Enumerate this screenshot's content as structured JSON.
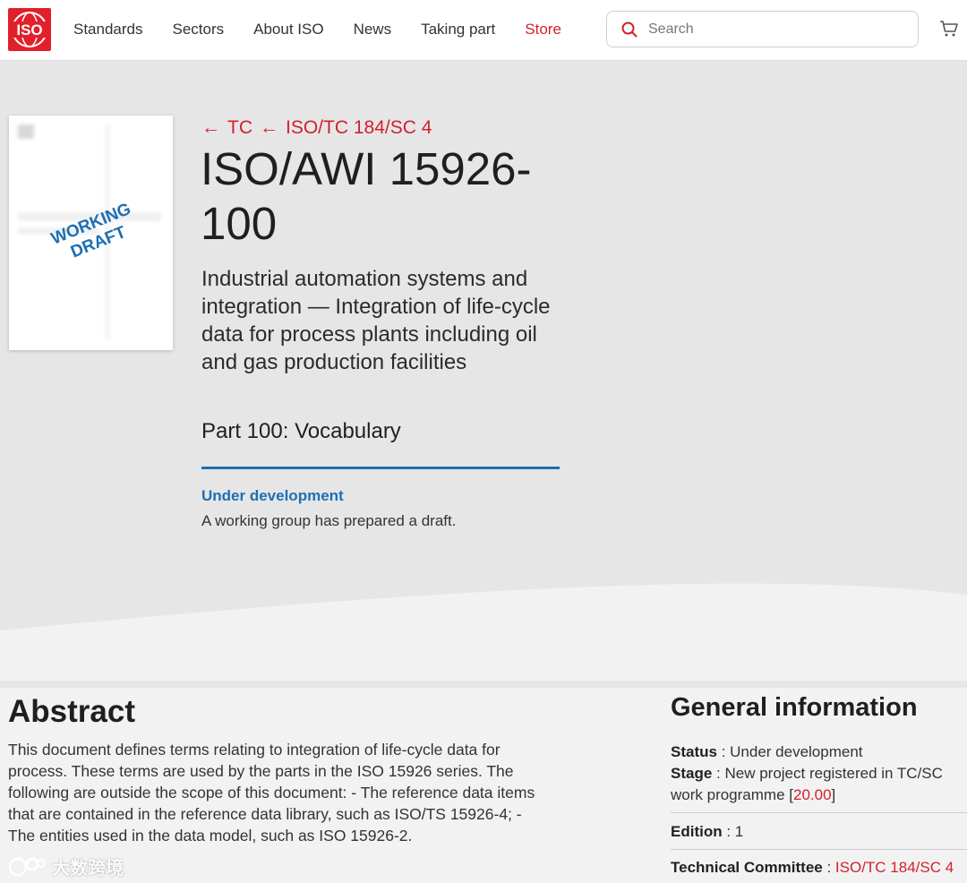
{
  "header": {
    "logo_text": "ISO",
    "nav": [
      {
        "label": "Standards"
      },
      {
        "label": "Sectors"
      },
      {
        "label": "About ISO"
      },
      {
        "label": "News"
      },
      {
        "label": "Taking part"
      },
      {
        "label": "Store"
      }
    ],
    "search_placeholder": "Search",
    "accent_color": "#d3202e"
  },
  "hero": {
    "cover_stamp_line1": "WORKING",
    "cover_stamp_line2": "DRAFT",
    "breadcrumb": [
      {
        "arrow": "←",
        "label": "TC"
      },
      {
        "arrow": "←",
        "label": "ISO/TC 184/SC 4"
      }
    ],
    "title": "ISO/AWI 15926-100",
    "subtitle": "Industrial automation systems and integration — Integration of life-cycle data for process plants including oil and gas production facilities",
    "part": "Part 100: Vocabulary",
    "status_label": "Under development",
    "status_description": "A working group has prepared a draft.",
    "status_color": "#1d6fb4"
  },
  "abstract": {
    "heading": "Abstract",
    "body": "This document defines terms relating to integration of life-cycle data for process. These terms are used by the parts in the ISO 15926 series. The following are outside the scope of this document: - The reference data items that are contained in the reference data library, such as ISO/TS 15926-4; - The entities used in the data model, such as ISO 15926-2."
  },
  "general_info": {
    "heading": "General information",
    "status_key": "Status",
    "status_value": "Under development",
    "stage_key": "Stage",
    "stage_value": "New project registered in TC/SC work programme",
    "stage_code": "20.00",
    "edition_key": "Edition",
    "edition_value": "1",
    "tc_key": "Technical Committee",
    "tc_value": "ISO/TC 184/SC 4"
  },
  "watermark": {
    "text": "大数跨境"
  }
}
